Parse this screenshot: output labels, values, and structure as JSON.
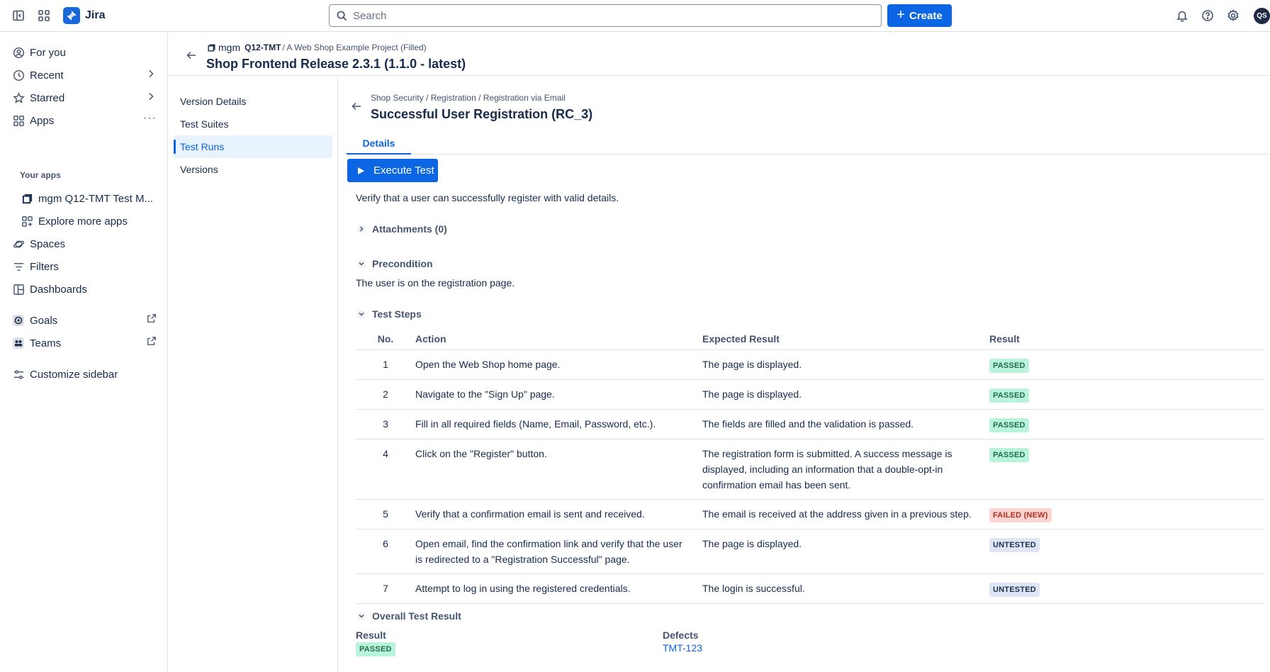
{
  "topbar": {
    "app_name": "Jira",
    "search_placeholder": "Search",
    "create_label": "Create",
    "avatar_initials": "QS"
  },
  "sidebar": {
    "items": [
      {
        "label": "For you",
        "icon": "person-circle-icon"
      },
      {
        "label": "Recent",
        "icon": "clock-icon"
      },
      {
        "label": "Starred",
        "icon": "star-icon"
      },
      {
        "label": "Apps",
        "icon": "apps-icon"
      }
    ],
    "your_apps_heading": "Your apps",
    "app_items": [
      {
        "label": "mgm Q12-TMT Test M...",
        "icon": "mgm-logo-icon"
      },
      {
        "label": "Explore more apps",
        "icon": "apps-add-icon"
      }
    ],
    "items2": [
      {
        "label": "Spaces",
        "icon": "spaces-icon"
      },
      {
        "label": "Filters",
        "icon": "filter-icon"
      },
      {
        "label": "Dashboards",
        "icon": "dashboard-icon"
      },
      {
        "label": "Goals",
        "icon": "goals-icon"
      },
      {
        "label": "Teams",
        "icon": "teams-icon"
      },
      {
        "label": "Customize sidebar",
        "icon": "customize-icon"
      }
    ]
  },
  "project": {
    "mgm": "mgm",
    "key": "Q12-TMT",
    "crumb_rest": "/ A Web Shop Example Project (Filled)",
    "title": "Shop Frontend Release 2.3.1 (1.1.0 - latest)"
  },
  "subnav": {
    "items": [
      "Version Details",
      "Test Suites",
      "Test Runs",
      "Versions"
    ],
    "active": "Test Runs"
  },
  "testcase": {
    "breadcrumb": "Shop Security / Registration / Registration via Email",
    "title": "Successful User Registration (RC_3)",
    "tab": "Details",
    "execute_label": "Execute Test",
    "description": "Verify that a user can successfully register with valid details.",
    "attachments_label": "Attachments (0)",
    "precondition_label": "Precondition",
    "precondition_text": "The user is on the registration page.",
    "steps_label": "Test Steps",
    "columns": {
      "no": "No.",
      "action": "Action",
      "expected": "Expected Result",
      "result": "Result"
    },
    "steps": [
      {
        "no": "1",
        "action": "Open the Web Shop home page.",
        "expected": "The page is displayed.",
        "result": "PASSED",
        "status": "passed"
      },
      {
        "no": "2",
        "action": "Navigate to the \"Sign Up\" page.",
        "expected": "The page is displayed.",
        "result": "PASSED",
        "status": "passed"
      },
      {
        "no": "3",
        "action": "Fill in all required fields (Name, Email, Password, etc.).",
        "expected": "The fields are filled and the validation is passed.",
        "result": "PASSED",
        "status": "passed"
      },
      {
        "no": "4",
        "action": "Click on the \"Register\" button.",
        "expected": "The registration form is submitted. A success message is displayed, including an information that a double-opt-in confirmation email has been sent.",
        "result": "PASSED",
        "status": "passed"
      },
      {
        "no": "5",
        "action": "Verify that a confirmation email is sent and received.",
        "expected": "The email is received at the address given in a previous step.",
        "result": "FAILED (NEW)",
        "status": "failed"
      },
      {
        "no": "6",
        "action": "Open email, find the confirmation link and verify that the user is redirected to a \"Registration Successful\" page.",
        "expected": "The page is displayed.",
        "result": "UNTESTED",
        "status": "untested"
      },
      {
        "no": "7",
        "action": "Attempt to log in using the registered credentials.",
        "expected": "The login is successful.",
        "result": "UNTESTED",
        "status": "untested"
      }
    ],
    "overall_label": "Overall Test Result",
    "result_label": "Result",
    "result_value": "PASSED",
    "defects_label": "Defects",
    "defect_value": "TMT-123"
  },
  "colors": {
    "accent": "#0c66e4",
    "passed_bg": "#baf3db",
    "failed_bg": "#ffd5d2",
    "untested_bg": "#dee6f5"
  }
}
